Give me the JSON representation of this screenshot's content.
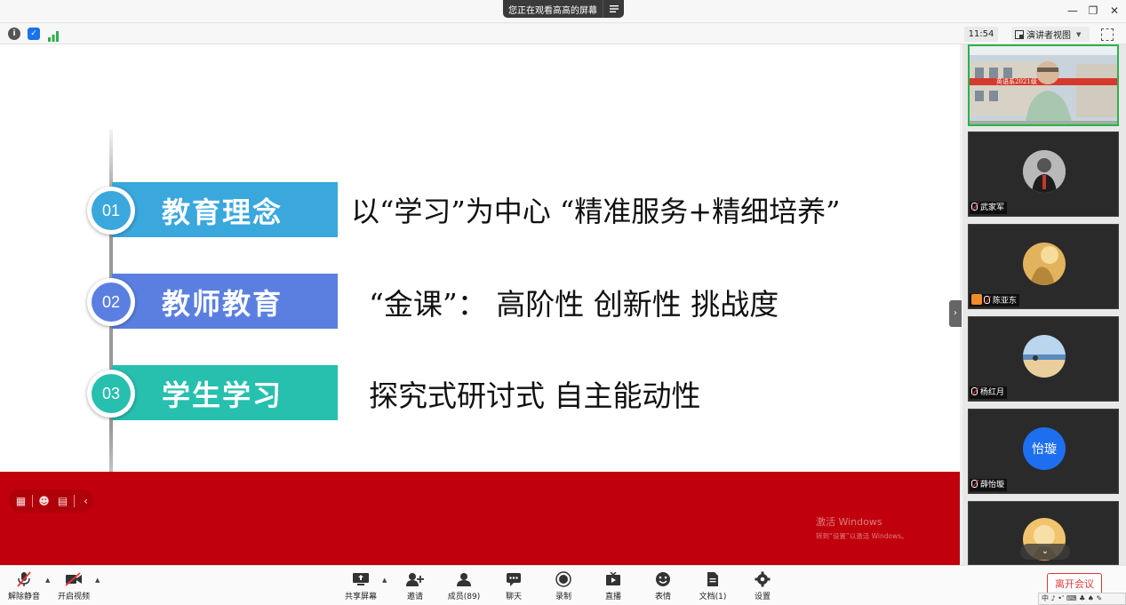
{
  "titlebar": {
    "share_banner": "您正在观看高高的屏幕",
    "minimize": "—",
    "restore": "❐",
    "close": "✕"
  },
  "infobar": {
    "time": "11:54",
    "view_mode": "演讲者视图"
  },
  "slide": {
    "rows": [
      {
        "num": "01",
        "label": "教育理念",
        "desc": "以“学习”为中心 “精准服务+精细培养”",
        "color": "#3aa7dd"
      },
      {
        "num": "02",
        "label": "教师教育",
        "desc": "“金课”： 高阶性 创新性 挑战度",
        "color": "#5a7fe0"
      },
      {
        "num": "03",
        "label": "学生学习",
        "desc": "探究式研讨式 自主能动性",
        "color": "#27bfae"
      }
    ],
    "watermark_title": "激活 Windows",
    "watermark_sub": "转到“设置”以激活 Windows。"
  },
  "participants": {
    "active": {
      "name": "高高",
      "banner_text": "英语系2021级"
    },
    "tiles": [
      {
        "name": "武家军",
        "avatar_color": "#6b6b6b"
      },
      {
        "name": "陈亚东",
        "avatar_color": "#d9a54a"
      },
      {
        "name": "杨红月",
        "avatar_color": "#7aa6c8"
      },
      {
        "name": "薛怡璇",
        "avatar_text": "怡璇",
        "avatar_color": "#1e6ff0"
      },
      {
        "name": "",
        "avatar_color": "#e8b85a"
      }
    ]
  },
  "toolbar": {
    "unmute": "解除静音",
    "start_video": "开启视频",
    "share_screen": "共享屏幕",
    "invite": "邀请",
    "members": "成员(89)",
    "chat": "聊天",
    "record": "录制",
    "live": "直播",
    "reactions": "表情",
    "docs": "文档(1)",
    "settings": "设置",
    "leave": "离开会议",
    "ime": "中 ♪ •ʼ ⌨ ♣ ♠ ✎"
  }
}
